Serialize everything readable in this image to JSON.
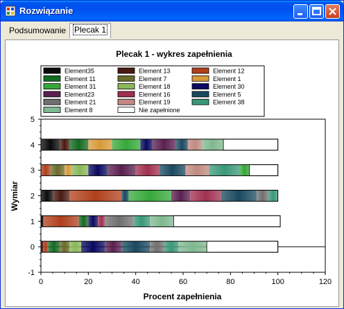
{
  "window": {
    "title": "Rozwiązanie",
    "minimize_icon": "minimize-icon",
    "maximize_icon": "maximize-icon",
    "close_icon": "close-icon"
  },
  "tabs": [
    {
      "label": "Podsumowanie"
    },
    {
      "label": "Plecak 1"
    }
  ],
  "chart_data": {
    "type": "bar",
    "orientation": "horizontal-stacked",
    "title": "Plecak 1 - wykres zapełnienia",
    "xlabel": "Procent zapełnienia",
    "ylabel": "Wymiar",
    "xlim": [
      0,
      120
    ],
    "ylim": [
      -1,
      5
    ],
    "xticks": [
      "0",
      "20",
      "40",
      "60",
      "80",
      "100",
      "120"
    ],
    "yticks": [
      "-1",
      "0",
      "1",
      "2",
      "3",
      "4",
      "5"
    ],
    "grid": false,
    "legend_position": "top",
    "legend": [
      {
        "name": "Element35",
        "color": "#0a0a0a"
      },
      {
        "name": "Element 13",
        "color": "#4a1a12"
      },
      {
        "name": "Element 12",
        "color": "#b0401c"
      },
      {
        "name": "Element 11",
        "color": "#156a22"
      },
      {
        "name": "Element 7",
        "color": "#6b6b2a"
      },
      {
        "name": "Element 1",
        "color": "#d89a3a"
      },
      {
        "name": "Element 31",
        "color": "#36a83a"
      },
      {
        "name": "Element 18",
        "color": "#8ab85a"
      },
      {
        "name": "Element 30",
        "color": "#0a0a60"
      },
      {
        "name": "Element23",
        "color": "#5a2050"
      },
      {
        "name": "Element 16",
        "color": "#a03050"
      },
      {
        "name": "Element 5",
        "color": "#1a4a60"
      },
      {
        "name": "Element 21",
        "color": "#707070"
      },
      {
        "name": "Element 19",
        "color": "#c08a80"
      },
      {
        "name": "Element 38",
        "color": "#3a9878"
      },
      {
        "name": "Element 8",
        "color": "#80b890"
      },
      {
        "name": "Nie zapełnione",
        "color": "#ffffff"
      }
    ],
    "series": [
      {
        "dimension": 0,
        "segments": [
          {
            "element": "Element 13",
            "value": 1
          },
          {
            "element": "Element 12",
            "value": 2
          },
          {
            "element": "Element 11",
            "value": 5
          },
          {
            "element": "Element 7",
            "value": 4
          },
          {
            "element": "Element 18",
            "value": 5
          },
          {
            "element": "Element 30",
            "value": 10
          },
          {
            "element": "Element23",
            "value": 7
          },
          {
            "element": "Element 5",
            "value": 12
          },
          {
            "element": "Element 21",
            "value": 6
          },
          {
            "element": "Element 38",
            "value": 6
          },
          {
            "element": "Element 8",
            "value": 12
          },
          {
            "element": "Nie zapełnione",
            "value": 30
          }
        ]
      },
      {
        "dimension": 1,
        "segments": [
          {
            "element": "Element35",
            "value": 1
          },
          {
            "element": "Element 12",
            "value": 15
          },
          {
            "element": "Element 11",
            "value": 4
          },
          {
            "element": "Element 30",
            "value": 4
          },
          {
            "element": "Element 16",
            "value": 3
          },
          {
            "element": "Element 21",
            "value": 12
          },
          {
            "element": "Element 38",
            "value": 7
          },
          {
            "element": "Element 8",
            "value": 10
          },
          {
            "element": "Nie zapełnione",
            "value": 45
          }
        ]
      },
      {
        "dimension": 2,
        "segments": [
          {
            "element": "Element35",
            "value": 5
          },
          {
            "element": "Element 13",
            "value": 7
          },
          {
            "element": "Element 12",
            "value": 22
          },
          {
            "element": "Element 5",
            "value": 3
          },
          {
            "element": "Element 31",
            "value": 18
          },
          {
            "element": "Element23",
            "value": 8
          },
          {
            "element": "Element 16",
            "value": 13
          },
          {
            "element": "Element 5",
            "value": 15
          },
          {
            "element": "Element 21",
            "value": 5
          },
          {
            "element": "Element 38",
            "value": 4
          }
        ]
      },
      {
        "dimension": 3,
        "segments": [
          {
            "element": "Element 12",
            "value": 4
          },
          {
            "element": "Element 7",
            "value": 6
          },
          {
            "element": "Element 1",
            "value": 3
          },
          {
            "element": "Element 18",
            "value": 7
          },
          {
            "element": "Element 30",
            "value": 8
          },
          {
            "element": "Element23",
            "value": 12
          },
          {
            "element": "Element 16",
            "value": 10
          },
          {
            "element": "Element 5",
            "value": 11
          },
          {
            "element": "Element 19",
            "value": 10
          },
          {
            "element": "Element 38",
            "value": 13
          },
          {
            "element": "Element 31",
            "value": 4
          },
          {
            "element": "Nie zapełnione",
            "value": 12
          }
        ]
      },
      {
        "dimension": 4,
        "segments": [
          {
            "element": "Element35",
            "value": 8
          },
          {
            "element": "Element 13",
            "value": 4
          },
          {
            "element": "Element 11",
            "value": 8
          },
          {
            "element": "Element 1",
            "value": 10
          },
          {
            "element": "Element 31",
            "value": 12
          },
          {
            "element": "Element 30",
            "value": 5
          },
          {
            "element": "Element23",
            "value": 10
          },
          {
            "element": "Element 5",
            "value": 5
          },
          {
            "element": "Element 19",
            "value": 6
          },
          {
            "element": "Element 8",
            "value": 9
          },
          {
            "element": "Nie zapełnione",
            "value": 23
          }
        ]
      }
    ]
  }
}
